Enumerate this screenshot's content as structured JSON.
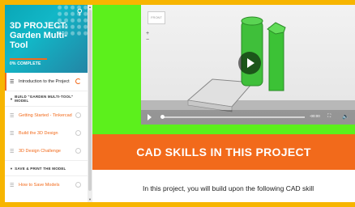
{
  "sidebar": {
    "title": "3D PROJECT: Garden Multi-Tool",
    "complete": "0% COMPLETE",
    "items": [
      {
        "label": "Introduction to the Project",
        "active": true
      },
      {
        "section": "BUILD \"GARDEN MULTI-TOOL\" MODEL"
      },
      {
        "label": "Getting Started - Tinkercad"
      },
      {
        "label": "Build the 3D Design"
      },
      {
        "label": "3D Design Challenge"
      },
      {
        "section": "SAVE & PRINT THE MODEL"
      },
      {
        "label": "How to Save Models"
      }
    ]
  },
  "video": {
    "viewcube": "FRONT",
    "time": "-00:00"
  },
  "main": {
    "banner": "CAD SKILLS IN THIS PROJECT",
    "description": "In this project, you will build upon the following CAD skill"
  },
  "colors": {
    "frame": "#f7b500",
    "accent": "#f26a1b",
    "green": "#5cf01c",
    "shape": "#3fbf3a"
  }
}
